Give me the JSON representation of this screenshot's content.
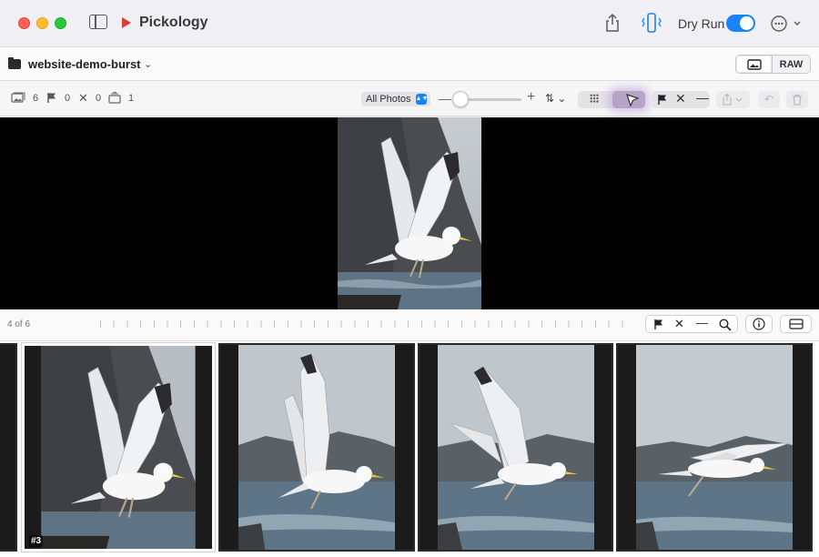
{
  "app": {
    "title": "Pickology",
    "dry_run_label": "Dry Run",
    "dry_run_on": true
  },
  "folder": {
    "name": "website-demo-burst",
    "raw_label": "RAW"
  },
  "stats": {
    "photos": "6",
    "flagged": "0",
    "rejected": "0",
    "stacks": "1"
  },
  "filter": {
    "label": "All Photos"
  },
  "viewer": {
    "counter": "4 of 6"
  },
  "filmstrip": {
    "badge": "#3"
  },
  "colors": {
    "accent": "#1a82fb",
    "close": "#ff5f57",
    "minimize": "#febc2e",
    "zoom": "#28c840",
    "app_logo": "#e03a2f",
    "loupe_highlight": "#b6a4c8"
  }
}
